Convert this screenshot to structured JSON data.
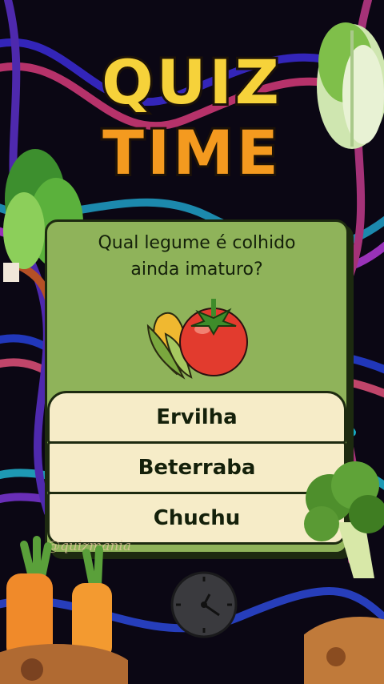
{
  "title": {
    "line1": "QUIZ",
    "line2": "TIME"
  },
  "question": {
    "line1": "Qual legume é colhido",
    "line2": "ainda imaturo?"
  },
  "answers": [
    "Ervilha",
    "Beterraba",
    "Chuchu"
  ],
  "watermark": "@quizmania",
  "icons": [
    "corn-icon",
    "tomato-icon",
    "clock-icon",
    "lettuce-icon",
    "spinach-icon",
    "broccoli-icon",
    "carrot-icon"
  ]
}
